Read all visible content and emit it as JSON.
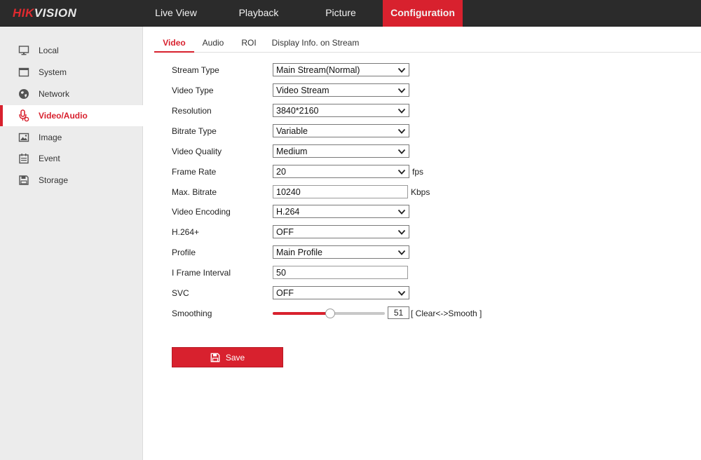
{
  "brand": {
    "logo_red": "HIK",
    "logo_rest": "VISION",
    "accent_color": "#d8212e"
  },
  "nav": {
    "items": [
      {
        "label": "Live View",
        "active": false
      },
      {
        "label": "Playback",
        "active": false
      },
      {
        "label": "Picture",
        "active": false
      },
      {
        "label": "Configuration",
        "active": true
      }
    ]
  },
  "sidebar": {
    "items": [
      {
        "label": "Local",
        "icon": "monitor-icon",
        "active": false
      },
      {
        "label": "System",
        "icon": "window-icon",
        "active": false
      },
      {
        "label": "Network",
        "icon": "globe-icon",
        "active": false
      },
      {
        "label": "Video/Audio",
        "icon": "microphone-icon",
        "active": true
      },
      {
        "label": "Image",
        "icon": "image-icon",
        "active": false
      },
      {
        "label": "Event",
        "icon": "calendar-icon",
        "active": false
      },
      {
        "label": "Storage",
        "icon": "floppy-disk-icon",
        "active": false
      }
    ]
  },
  "tabs": {
    "items": [
      {
        "label": "Video",
        "active": true
      },
      {
        "label": "Audio",
        "active": false
      },
      {
        "label": "ROI",
        "active": false
      },
      {
        "label": "Display Info. on Stream",
        "active": false
      }
    ]
  },
  "form": {
    "stream_type": {
      "label": "Stream Type",
      "value": "Main Stream(Normal)"
    },
    "video_type": {
      "label": "Video Type",
      "value": "Video Stream"
    },
    "resolution": {
      "label": "Resolution",
      "value": "3840*2160"
    },
    "bitrate_type": {
      "label": "Bitrate Type",
      "value": "Variable"
    },
    "video_quality": {
      "label": "Video Quality",
      "value": "Medium"
    },
    "frame_rate": {
      "label": "Frame Rate",
      "value": "20",
      "unit": "fps"
    },
    "max_bitrate": {
      "label": "Max. Bitrate",
      "value": "10240",
      "unit": "Kbps"
    },
    "video_encoding": {
      "label": "Video Encoding",
      "value": "H.264"
    },
    "h264plus": {
      "label": "H.264+",
      "value": "OFF"
    },
    "profile": {
      "label": "Profile",
      "value": "Main Profile"
    },
    "iframe_interval": {
      "label": "I Frame Interval",
      "value": "50"
    },
    "svc": {
      "label": "SVC",
      "value": "OFF"
    },
    "smoothing": {
      "label": "Smoothing",
      "value": "51",
      "level": 51,
      "max": 100,
      "hint": "[ Clear<->Smooth ]"
    }
  },
  "actions": {
    "save_label": "Save"
  }
}
